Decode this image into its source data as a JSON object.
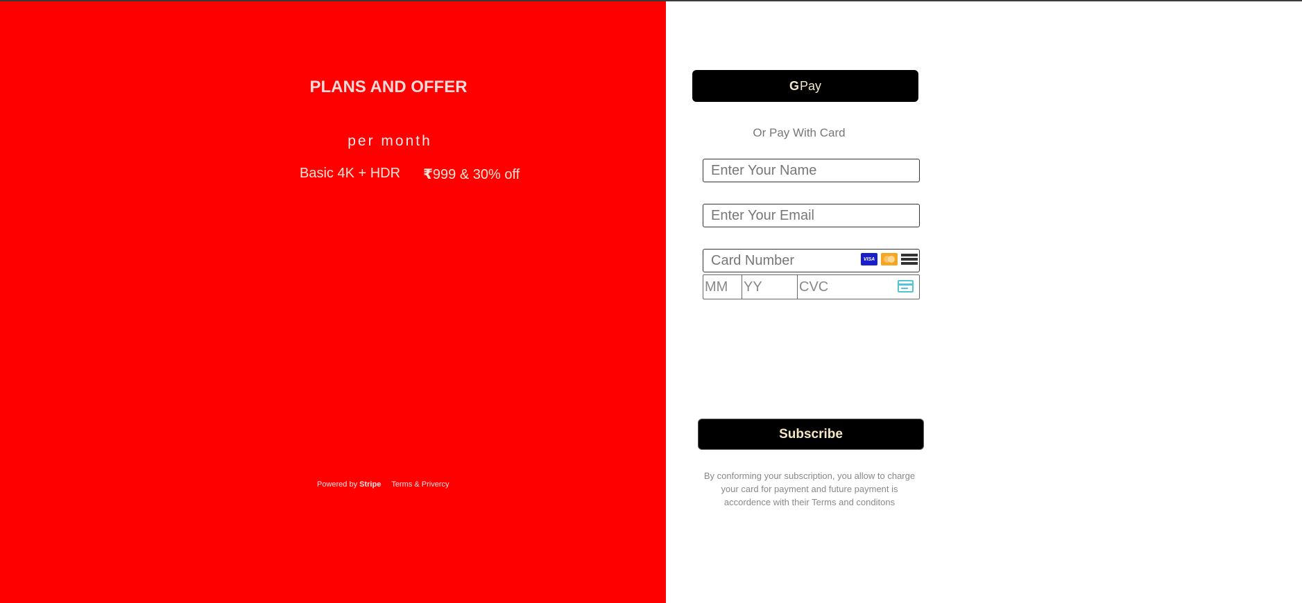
{
  "plans": {
    "title": "PLANS AND OFFER",
    "period": "per month",
    "plan_name": "Basic 4K + HDR",
    "currency_symbol": "₹",
    "price_text": "999 & 30% off"
  },
  "footer": {
    "powered_by": "Powered by",
    "brand": "Stripe",
    "terms": "Terms & Privercy"
  },
  "payment": {
    "gpay_g": "G",
    "gpay_label": "Pay",
    "or_text": "Or Pay With Card",
    "name_placeholder": "Enter Your Name",
    "email_placeholder": "Enter Your Email",
    "card_placeholder": "Card Number",
    "mm_placeholder": "MM",
    "yy_placeholder": "YY",
    "cvc_placeholder": "CVC",
    "card_brand_visa": "VISA",
    "subscribe_label": "Subscribe",
    "disclaimer": "By conforming your subscription, you allow to charge your card for payment and future payment is accordence with their Terms and conditons"
  },
  "icons": [
    "visa-icon",
    "mastercard-icon",
    "generic-card-icon",
    "cvc-card-icon"
  ],
  "colors": {
    "left_panel": "#ff0000",
    "button_bg": "#000000",
    "button_text": "#f5e6c4"
  }
}
